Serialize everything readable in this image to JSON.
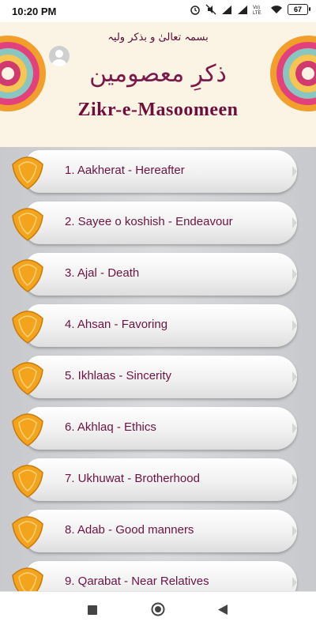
{
  "status": {
    "time": "10:20 PM",
    "battery": "67"
  },
  "header": {
    "bismillah": "بسمہ تعالیٰ و بذکر ولیہ",
    "title_urdu": "ذکرِ معصومین",
    "title_english": "Zikr-e-Masoomeen"
  },
  "topics": [
    {
      "label": "1. Aakherat - Hereafter"
    },
    {
      "label": "2. Sayee o koshish - Endeavour"
    },
    {
      "label": "3. Ajal -  Death"
    },
    {
      "label": "4. Ahsan  - Favoring"
    },
    {
      "label": "5. Ikhlaas - Sincerity"
    },
    {
      "label": "6. Akhlaq - Ethics"
    },
    {
      "label": "7. Ukhuwat - Brotherhood"
    },
    {
      "label": "8. Adab - Good manners"
    },
    {
      "label": "9. Qarabat - Near Relatives"
    }
  ],
  "colors": {
    "title": "#6e0e3c",
    "item_text": "#6b1443",
    "badge": "#f4a41c"
  },
  "icons": {
    "user": "user-icon",
    "badge": "ornament-badge-icon",
    "nav_recent": "square-icon",
    "nav_home": "circle-icon",
    "nav_back": "triangle-back-icon"
  }
}
